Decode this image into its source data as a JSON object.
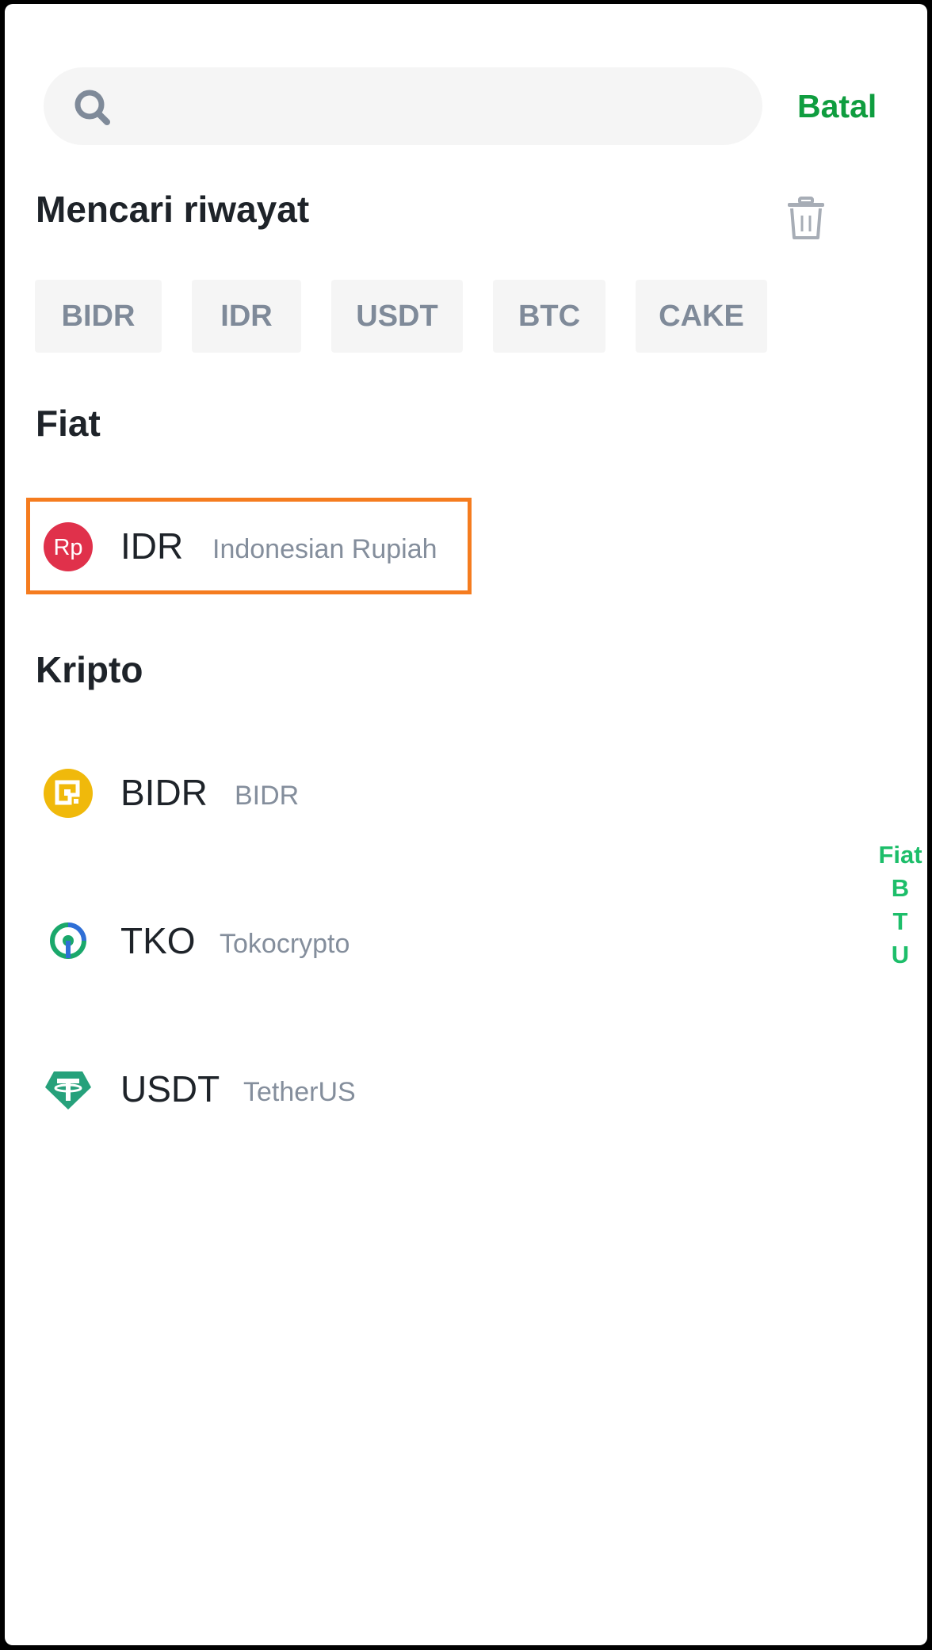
{
  "search": {
    "placeholder": "",
    "value": "",
    "cancel_label": "Batal"
  },
  "history": {
    "title": "Mencari riwayat",
    "chips": [
      "BIDR",
      "IDR",
      "USDT",
      "BTC",
      "CAKE"
    ]
  },
  "fiat": {
    "title": "Fiat",
    "items": [
      {
        "symbol": "IDR",
        "name": "Indonesian Rupiah",
        "icon": "rupiah-icon",
        "color": "#e0314b"
      }
    ]
  },
  "crypto": {
    "title": "Kripto",
    "items": [
      {
        "symbol": "BIDR",
        "name": "BIDR",
        "icon": "bidr-icon",
        "color": "#f0b90b"
      },
      {
        "symbol": "TKO",
        "name": "Tokocrypto",
        "icon": "tokocrypto-icon",
        "color": "#1aa86b"
      },
      {
        "symbol": "USDT",
        "name": "TetherUS",
        "icon": "tether-icon",
        "color": "#26a17b"
      }
    ]
  },
  "index_bar": [
    "Fiat",
    "B",
    "T",
    "U"
  ],
  "colors": {
    "accent": "#0f9d3f",
    "highlight": "#f57c1f",
    "index": "#1dbe6a"
  }
}
